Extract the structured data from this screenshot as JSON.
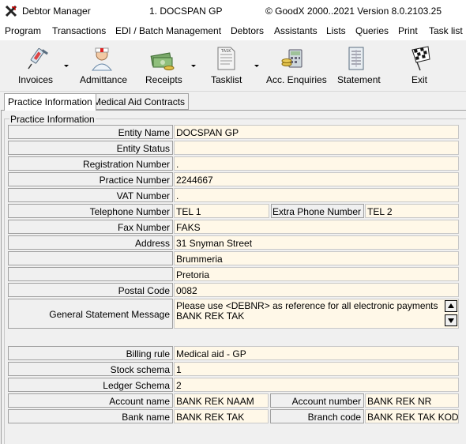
{
  "window": {
    "app_name": "Debtor Manager",
    "practice": "1. DOCSPAN GP",
    "version": "© GoodX 2000..2021  Version 8.0.2103.25"
  },
  "menu": [
    "Program",
    "Transactions",
    "EDI / Batch Management",
    "Debtors",
    "Assistants",
    "Lists",
    "Queries",
    "Print",
    "Task list"
  ],
  "toolbar": {
    "invoices": "Invoices",
    "admittance": "Admittance",
    "receipts": "Receipts",
    "tasklist": "Tasklist",
    "acc_enquiries": "Acc. Enquiries",
    "statement": "Statement",
    "exit": "Exit"
  },
  "tabs": {
    "practice_information": "Practice Information",
    "medical_aid_contracts": "Medical Aid Contracts"
  },
  "group_title": "Practice Information",
  "form": {
    "entity_name_label": "Entity Name",
    "entity_name": "DOCSPAN GP",
    "entity_status_label": "Entity Status",
    "entity_status": "",
    "registration_number_label": "Registration Number",
    "registration_number": ".",
    "practice_number_label": "Practice Number",
    "practice_number": "2244667",
    "vat_number_label": "VAT Number",
    "vat_number": ".",
    "telephone_number_label": "Telephone Number",
    "telephone_number": "TEL 1",
    "extra_phone_number_label": "Extra Phone Number",
    "extra_phone_number": "TEL 2",
    "fax_number_label": "Fax Number",
    "fax_number": "FAKS",
    "address_label": "Address",
    "address_line1": "31 Snyman Street",
    "address_line2": "Brummeria",
    "address_line3": "Pretoria",
    "postal_code_label": "Postal Code",
    "postal_code": "0082",
    "general_statement_message_label": "General Statement Message",
    "general_statement_message_line1": "Please use <DEBNR> as reference  for all electronic payments",
    "general_statement_message_line2": "BANK REK TAK",
    "billing_rule_label": "Billing rule",
    "billing_rule": "Medical aid - GP",
    "stock_schema_label": "Stock schema",
    "stock_schema": "1",
    "ledger_schema_label": "Ledger Schema",
    "ledger_schema": "2",
    "account_name_label": "Account name",
    "account_name": "BANK REK NAAM",
    "account_number_label": "Account number",
    "account_number": "BANK REK NR",
    "bank_name_label": "Bank name",
    "bank_name": "BANK REK TAK",
    "branch_code_label": "Branch code",
    "branch_code": "BANK REK TAK KODE"
  }
}
